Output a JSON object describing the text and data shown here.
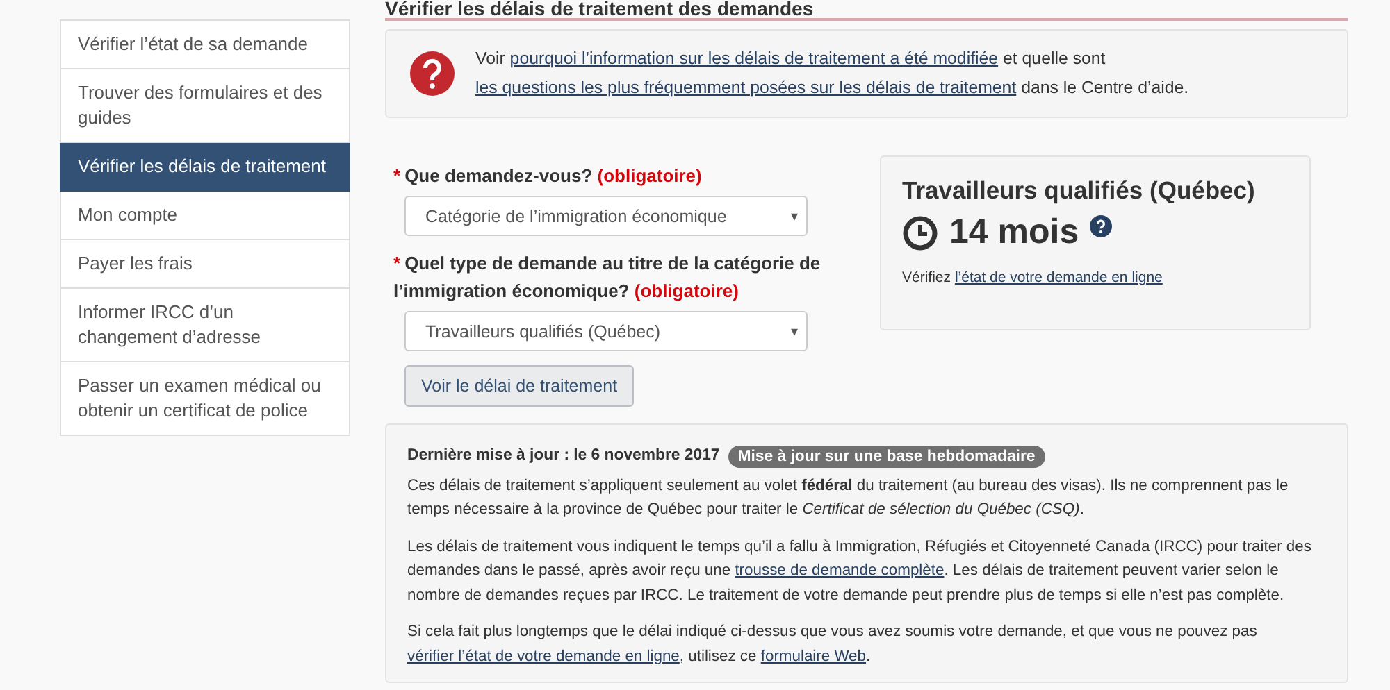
{
  "page_title": "Vérifier les délais de traitement des demandes",
  "sidebar": {
    "items": [
      {
        "label": "Vérifier l’état de sa demande",
        "selected": false
      },
      {
        "label": "Trouver des formulaires et des guides",
        "selected": false
      },
      {
        "label": "Vérifier les délais de traitement",
        "selected": true
      },
      {
        "label": "Mon compte",
        "selected": false
      },
      {
        "label": "Payer les frais",
        "selected": false
      },
      {
        "label": "Informer IRCC d’un changement d’adresse",
        "selected": false
      },
      {
        "label": "Passer un examen médical ou obtenir un certificat de police",
        "selected": false
      }
    ]
  },
  "notice": {
    "parts": [
      {
        "kind": "text",
        "text": "Voir "
      },
      {
        "kind": "link",
        "text": "pourquoi l’information sur les délais de traitement a été modifiée"
      },
      {
        "kind": "text",
        "text": " et quelle sont "
      },
      {
        "kind": "link",
        "text": "les questions les plus fréquemment posées sur les délais de traitement"
      },
      {
        "kind": "text",
        "text": " dans le Centre d’aide."
      }
    ]
  },
  "form": {
    "fields": [
      {
        "required_mark": "*",
        "label": "Que demandez-vous?",
        "required_note": "(obligatoire)",
        "value": "Catégorie de l’immigration économique",
        "arrow": "▾"
      },
      {
        "required_mark": "*",
        "label": "Quel type de demande au titre de la catégorie de l’immigration économique?",
        "required_note": "(obligatoire)",
        "value": "Travailleurs qualifiés (Québec)",
        "arrow": "▾"
      }
    ],
    "button": "Voir le délai de traitement"
  },
  "result": {
    "title": "Travailleurs qualifiés (Québec)",
    "time": "14 mois",
    "parts": [
      {
        "kind": "text",
        "text": "Vérifiez "
      },
      {
        "kind": "link",
        "text": "l’état de votre demande en ligne"
      }
    ]
  },
  "notes": {
    "updated": "Dernière mise à jour : le 6 novembre 2017",
    "badge": "Mise à jour sur une base hebdomadaire",
    "paragraphs": [
      {
        "parts": [
          {
            "kind": "text",
            "text": "Ces délais de traitement s’appliquent seulement au volet **fédéral** du traitement (au bureau des visas). Ils ne comprennent pas le temps nécessaire à la province de Québec pour traiter le *Certificat de sélection du Québec (CSQ)*."
          }
        ]
      },
      {
        "parts": [
          {
            "kind": "text",
            "text": "Les délais de traitement vous indiquent le temps qu’il a fallu à Immigration, Réfugiés et Citoyenneté Canada (IRCC) pour traiter des demandes dans le passé, après avoir reçu une "
          },
          {
            "kind": "link",
            "text": "trousse de demande complète"
          },
          {
            "kind": "text",
            "text": ". Les délais de traitement peuvent varier selon le nombre de demandes reçues par IRCC. Le traitement de votre demande peut prendre plus de temps si elle n’est pas complète."
          }
        ]
      },
      {
        "parts": [
          {
            "kind": "text",
            "text": "Si cela fait plus longtemps que le délai indiqué ci-dessus que vous avez soumis votre demande, et que vous ne pouvez pas "
          },
          {
            "kind": "link",
            "text": "vérifier l’état de votre demande en ligne"
          },
          {
            "kind": "text",
            "text": ", utilisez ce "
          },
          {
            "kind": "link",
            "text": "formulaire Web"
          },
          {
            "kind": "text",
            "text": "."
          }
        ]
      }
    ]
  }
}
